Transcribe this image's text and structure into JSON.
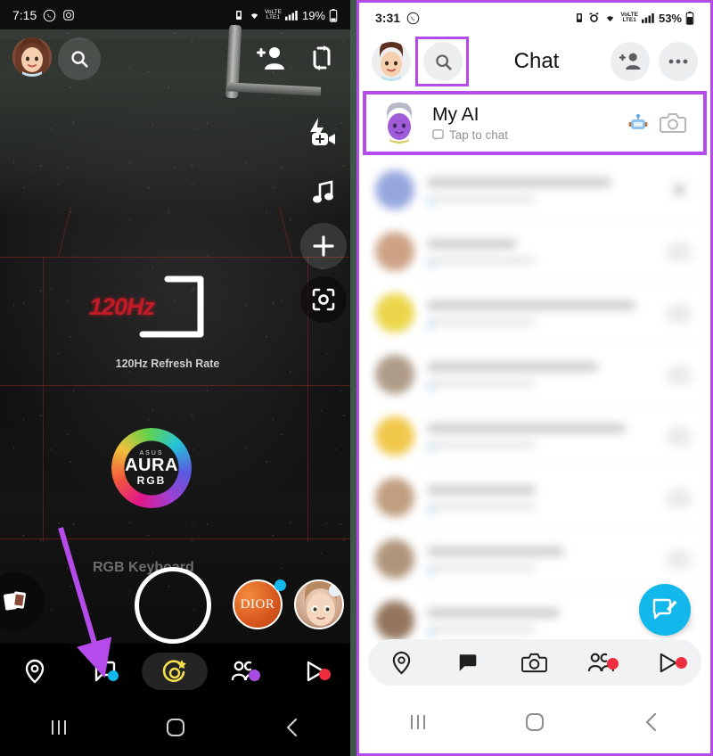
{
  "annotation": {
    "highlight_color": "#b44bea",
    "arrow_color": "#b44bea"
  },
  "left_phone": {
    "status_bar": {
      "time": "7:15",
      "left_icons": [
        "whatsapp-icon",
        "instagram-icon"
      ],
      "right_icons": [
        "nfc-icon",
        "wifi-icon",
        "volte-icon",
        "signal-icon"
      ],
      "battery_percent": "19%"
    },
    "top_bar": {
      "avatar": "bitmoji-avatar",
      "search_icon": "search-icon",
      "add_friend_icon": "add-friend-icon",
      "flip_camera_icon": "flip-camera-icon",
      "flash_icon": "flash-off-icon"
    },
    "side_tools": [
      "video-camera-icon",
      "music-note-icon",
      "plus-icon",
      "scan-icon"
    ],
    "camera_preview": {
      "overlay_hz": "120Hz",
      "overlay_caption": "120Hz Refresh Rate",
      "brand_small": "ASUS",
      "brand_main": "AURA",
      "brand_sub": "RGB",
      "subject_caption": "RGB Keyboard"
    },
    "carousel": {
      "memories_icon": "memories-icon",
      "shutter": "shutter-button",
      "lens_one_label": "DIOR",
      "lens_two_label": "face-lens"
    },
    "nav": [
      {
        "name": "map",
        "icon": "map-pin-icon",
        "badge": "blue"
      },
      {
        "name": "chat",
        "icon": "chat-bubble-icon",
        "badge": "blue"
      },
      {
        "name": "camera",
        "icon": "camera-star-icon",
        "badge": "none",
        "active": true
      },
      {
        "name": "stories",
        "icon": "friends-icon",
        "badge": "purple"
      },
      {
        "name": "spotlight",
        "icon": "play-icon",
        "badge": "red"
      }
    ],
    "system_nav": [
      "recents-icon",
      "home-icon",
      "back-icon"
    ]
  },
  "right_phone": {
    "status_bar": {
      "time": "3:31",
      "left_icons": [
        "whatsapp-icon"
      ],
      "right_icons": [
        "nfc-icon",
        "alarm-icon",
        "wifi-icon",
        "volte-icon",
        "signal-icon"
      ],
      "battery_percent": "53%"
    },
    "header": {
      "avatar": "bitmoji-avatar",
      "search_icon": "search-icon",
      "title": "Chat",
      "add_friend_icon": "add-friend-icon",
      "more_icon": "more-options-icon"
    },
    "my_ai_row": {
      "avatar": "my-ai-bitmoji",
      "name": "My AI",
      "subtitle": "Tap to chat",
      "status_icon": "chat-square-icon",
      "robot_icon": "robot-icon",
      "camera_icon": "camera-icon"
    },
    "chat_rows": [
      {
        "avatar_color": "#8ea0dc",
        "name_width": "78%",
        "action": "close-icon"
      },
      {
        "avatar_color": "#c99a7a",
        "name_width": "38%",
        "action": "camera-icon"
      },
      {
        "avatar_color": "#ead33c",
        "name_width": "88%",
        "action": "camera-icon"
      },
      {
        "avatar_color": "#a8937e",
        "name_width": "72%",
        "action": "camera-icon"
      },
      {
        "avatar_color": "#f0c33b",
        "name_width": "84%",
        "action": "camera-icon"
      },
      {
        "avatar_color": "#bb9676",
        "name_width": "46%",
        "action": "camera-icon"
      },
      {
        "avatar_color": "#a98c70",
        "name_width": "58%",
        "action": "camera-icon"
      },
      {
        "avatar_color": "#8a6a50",
        "name_width": "56%",
        "action": "camera-icon"
      }
    ],
    "fab": {
      "icon": "new-chat-icon",
      "color": "#12b7ec"
    },
    "nav": [
      {
        "name": "map",
        "icon": "map-pin-icon",
        "badge": "none"
      },
      {
        "name": "chat",
        "icon": "chat-bubble-filled-icon",
        "badge": "none",
        "active": true
      },
      {
        "name": "camera",
        "icon": "camera-icon",
        "badge": "none"
      },
      {
        "name": "stories",
        "icon": "friends-icon",
        "badge": "red"
      },
      {
        "name": "spotlight",
        "icon": "play-icon",
        "badge": "red"
      }
    ],
    "system_nav": [
      "recents-icon",
      "home-icon",
      "back-icon"
    ]
  }
}
